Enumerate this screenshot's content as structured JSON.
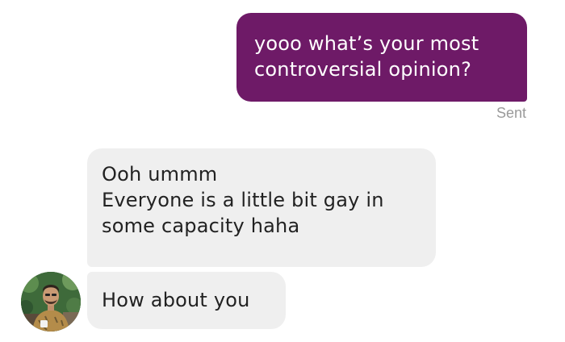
{
  "conversation": {
    "outgoing": {
      "lines": [
        "yooo what’s your most",
        "controversial opinion?"
      ],
      "status": "Sent"
    },
    "incoming": [
      {
        "lines": [
          "Ooh ummm",
          "Everyone is a little bit gay in",
          "some capacity haha"
        ]
      },
      {
        "lines": [
          "How about you"
        ]
      }
    ],
    "contact": {
      "avatar_icon": "person-photo-icon"
    }
  },
  "colors": {
    "sent_bubble": "#6e1a67",
    "received_bubble": "#efefef",
    "status_text": "#9a9a9a"
  }
}
